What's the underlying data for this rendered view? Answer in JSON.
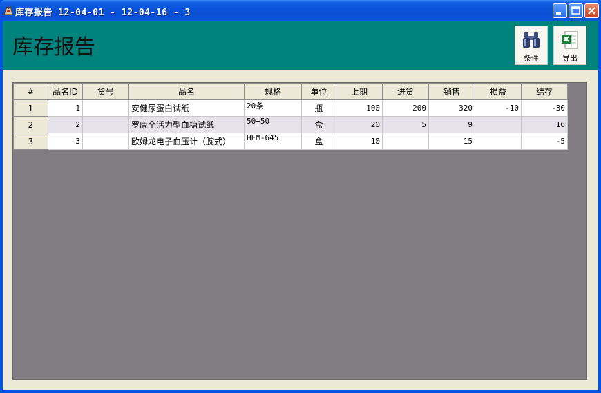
{
  "window": {
    "title": "库存报告 12-04-01 - 12-04-16 - 3"
  },
  "header": {
    "title": "库存报告",
    "buttons": {
      "condition": "条件",
      "export": "导出"
    }
  },
  "grid": {
    "columns": [
      "#",
      "品名ID",
      "货号",
      "品名",
      "规格",
      "单位",
      "上期",
      "进货",
      "销售",
      "损益",
      "结存"
    ],
    "rows": [
      {
        "n": "1",
        "id": "1",
        "sku": "",
        "name": "安健尿蛋白试纸",
        "spec": "20条",
        "unit": "瓶",
        "prev": "100",
        "in": "200",
        "sales": "320",
        "pl": "-10",
        "bal": "-30"
      },
      {
        "n": "2",
        "id": "2",
        "sku": "",
        "name": "罗康全活力型血糖试纸",
        "spec": "50+50",
        "unit": "盒",
        "prev": "20",
        "in": "5",
        "sales": "9",
        "pl": "",
        "bal": "16"
      },
      {
        "n": "3",
        "id": "3",
        "sku": "",
        "name": "欧姆龙电子血压计（腕式）",
        "spec": "HEM-645",
        "unit": "盒",
        "prev": "10",
        "in": "",
        "sales": "15",
        "pl": "",
        "bal": "-5"
      }
    ]
  },
  "colors": {
    "header_band": "#00837d",
    "grid_background": "#807c82",
    "alt_row": "#e5e2e9"
  }
}
